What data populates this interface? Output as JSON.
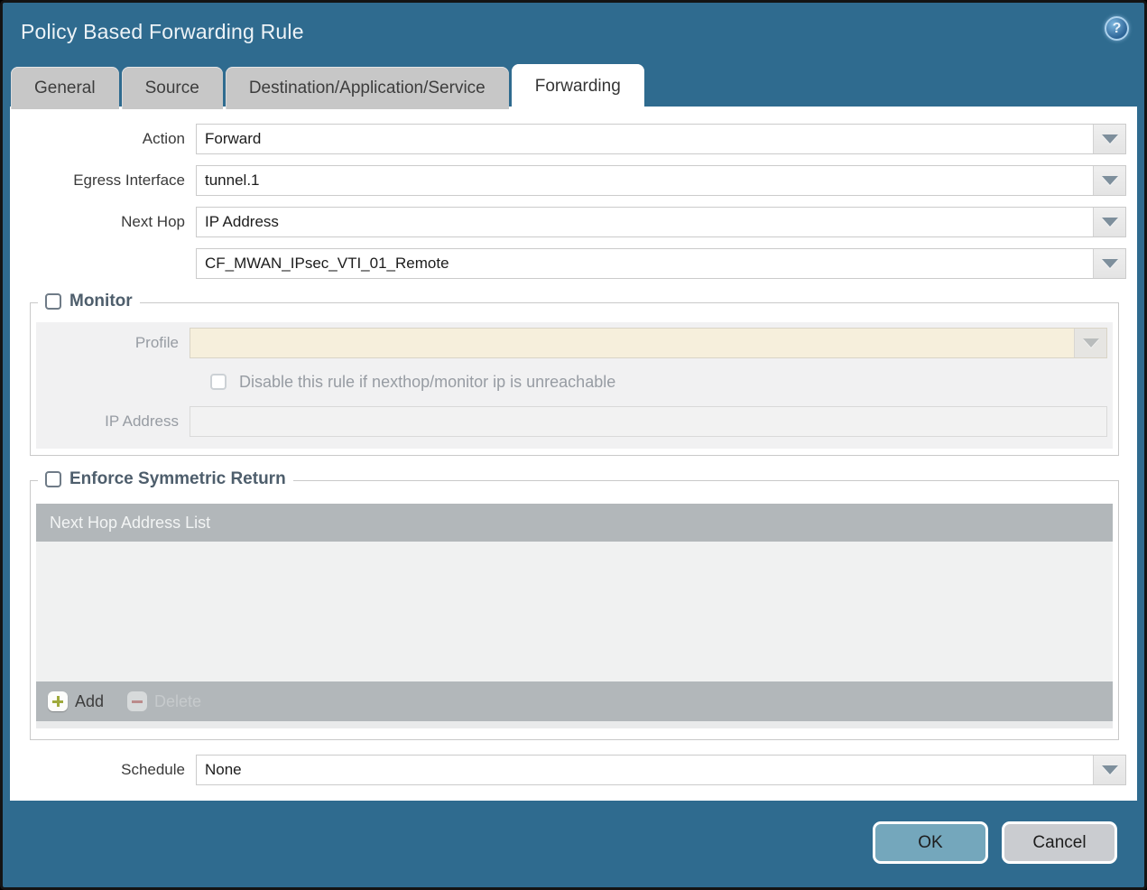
{
  "window": {
    "title": "Policy Based Forwarding Rule",
    "help_icon_glyph": "?"
  },
  "tabs": [
    {
      "label": "General",
      "active": false
    },
    {
      "label": "Source",
      "active": false
    },
    {
      "label": "Destination/Application/Service",
      "active": false
    },
    {
      "label": "Forwarding",
      "active": true
    }
  ],
  "form": {
    "action": {
      "label": "Action",
      "value": "Forward"
    },
    "egress_interface": {
      "label": "Egress Interface",
      "value": "tunnel.1"
    },
    "next_hop": {
      "label": "Next Hop",
      "value": "IP Address"
    },
    "next_hop_value": {
      "value": "CF_MWAN_IPsec_VTI_01_Remote"
    },
    "schedule": {
      "label": "Schedule",
      "value": "None"
    }
  },
  "monitor": {
    "legend": "Monitor",
    "checked": false,
    "profile": {
      "label": "Profile",
      "value": ""
    },
    "disable_rule": {
      "label": "Disable this rule if nexthop/monitor ip is unreachable",
      "checked": false
    },
    "ip_address": {
      "label": "IP Address",
      "value": ""
    }
  },
  "enforce_symmetric_return": {
    "legend": "Enforce Symmetric Return",
    "checked": false,
    "table": {
      "header": "Next Hop Address List",
      "rows": [],
      "add_label": "Add",
      "delete_label": "Delete"
    }
  },
  "footer": {
    "ok_label": "OK",
    "cancel_label": "Cancel"
  },
  "colors": {
    "frame_teal": "#2f6b8f",
    "tab_inactive": "#c7c7c7",
    "table_bar": "#b2b7ba",
    "profile_field_beige": "#f6efdc",
    "ok_button": "#74a7bc",
    "cancel_button": "#caccd0",
    "add_plus_green": "#9faa3c",
    "delete_minus_red": "#a84a4a"
  }
}
